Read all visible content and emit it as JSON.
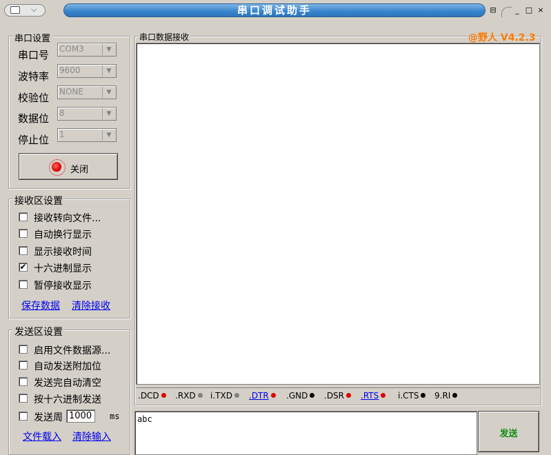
{
  "window": {
    "title": "串口调试助手",
    "controls": {
      "pin": "⊟",
      "minimize": "_",
      "maximize": "□",
      "close": "×"
    }
  },
  "port_settings": {
    "title": "串口设置",
    "fields": [
      {
        "label": "串口号",
        "value": "COM3"
      },
      {
        "label": "波特率",
        "value": "9600"
      },
      {
        "label": "校验位",
        "value": "NONE"
      },
      {
        "label": "数据位",
        "value": "8"
      },
      {
        "label": "停止位",
        "value": "1"
      }
    ],
    "toggle_button": "关闭",
    "led_color": "#e00000"
  },
  "receive_settings": {
    "title": "接收区设置",
    "options": [
      {
        "label": "接收转向文件...",
        "checked": false
      },
      {
        "label": "自动换行显示",
        "checked": false
      },
      {
        "label": "显示接收时间",
        "checked": false
      },
      {
        "label": "十六进制显示",
        "checked": true
      },
      {
        "label": "暂停接收显示",
        "checked": false
      }
    ],
    "links": {
      "save": "保存数据",
      "clear": "清除接收"
    }
  },
  "send_settings": {
    "title": "发送区设置",
    "options": [
      {
        "label": "启用文件数据源...",
        "checked": false
      },
      {
        "label": "自动发送附加位",
        "checked": false
      },
      {
        "label": "发送完自动清空",
        "checked": false
      },
      {
        "label": "按十六进制发送",
        "checked": false
      },
      {
        "label": "发送周",
        "checked": false
      }
    ],
    "period_value": "1000",
    "period_unit": "ms",
    "links": {
      "load": "文件载入",
      "clear": "清除输入"
    }
  },
  "receive_area": {
    "title": "串口数据接收",
    "brand": "@野人 V4.2.3",
    "brand_color": "#ff7a00"
  },
  "signals": [
    {
      "label": ".DCD",
      "color": "#e00000",
      "link": false
    },
    {
      "label": ".RXD",
      "color": "#808080",
      "link": false
    },
    {
      "label": "i.TXD",
      "color": "#808080",
      "link": false
    },
    {
      "label": ".DTR",
      "color": "#e00000",
      "link": true
    },
    {
      "label": ".GND",
      "color": "#000000",
      "link": false
    },
    {
      "label": ".DSR",
      "color": "#e00000",
      "link": false
    },
    {
      "label": ".RTS",
      "color": "#e00000",
      "link": true
    },
    {
      "label": "i.CTS",
      "color": "#000000",
      "link": false
    },
    {
      "label": "9.RI",
      "color": "#000000",
      "link": false
    }
  ],
  "send_area": {
    "value": "abc",
    "send_button": "发送",
    "send_button_color": "#108a10"
  }
}
